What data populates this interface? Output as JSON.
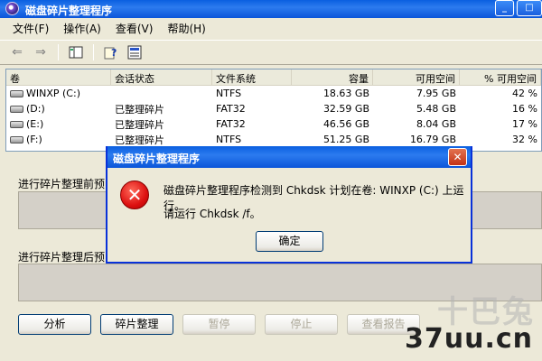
{
  "window": {
    "title": "磁盘碎片整理程序",
    "min": "_",
    "max": "□"
  },
  "menu": [
    "文件(F)",
    "操作(A)",
    "查看(V)",
    "帮助(H)"
  ],
  "table": {
    "headers": [
      "卷",
      "会话状态",
      "文件系统",
      "容量",
      "可用空间",
      "% 可用空间"
    ],
    "rows": [
      [
        "WINXP (C:)",
        "",
        "NTFS",
        "18.63 GB",
        "7.95 GB",
        "42 %"
      ],
      [
        "(D:)",
        "已整理碎片",
        "FAT32",
        "32.59 GB",
        "5.48 GB",
        "16 %"
      ],
      [
        "(E:)",
        "已整理碎片",
        "FAT32",
        "46.56 GB",
        "8.04 GB",
        "17 %"
      ],
      [
        "(F:)",
        "已整理碎片",
        "NTFS",
        "51.25 GB",
        "16.79 GB",
        "32 %"
      ]
    ]
  },
  "labels": {
    "before": "进行碎片整理前预",
    "after": "进行碎片整理后预"
  },
  "buttons": [
    "分析",
    "碎片整理",
    "暂停",
    "停止",
    "查看报告"
  ],
  "dialog": {
    "title": "磁盘碎片整理程序",
    "line1": "磁盘碎片整理程序检测到 Chkdsk 计划在卷: WINXP (C:) 上运行。",
    "line2": "请运行 Chkdsk /f。",
    "ok": "确定",
    "close": "✕"
  },
  "watermark": {
    "top": "十巴兔",
    "bottom": "37uu.cn"
  }
}
